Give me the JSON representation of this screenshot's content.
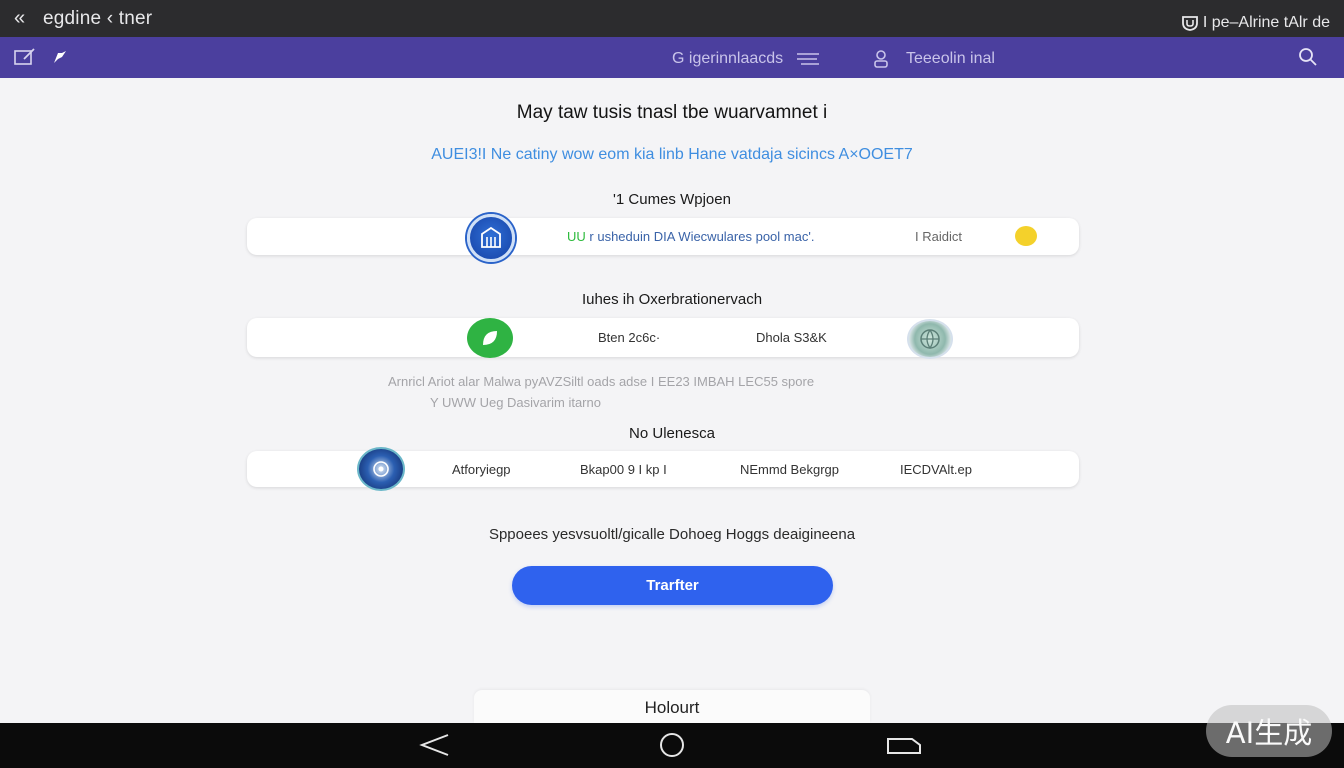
{
  "topbar": {
    "back_glyph": "«",
    "title": "egdine ‹ tner",
    "right_text": "I pe–Alrine tAlr de"
  },
  "navbar": {
    "center_label": "G igerinnlaacds",
    "right_label": "Teeeolin inal"
  },
  "main": {
    "headline": "May taw tusis tnasl tbe wuarvamnet i",
    "subline": "AUEI3!I Ne catiny wow eom kia linb Hane vatdaja sicincs A×OOET7",
    "section1": {
      "title": "'1 Cumes Wpjoen",
      "text_green": "UU",
      "text_main": "r usheduin DIA Wiecwulares pool mac'.",
      "right_label": "I Raidict"
    },
    "section2": {
      "title": "Iuhes ih Oxerbrationervach",
      "item_a": "Bten 2c6c·",
      "item_b": "Dhola S3&K"
    },
    "note_line1": "Arnricl Ariot alar Malwa pyAVZSiltl oads adse    I EE23 IMBAH LEC55 spore",
    "note_line2": "Y UWW Ueg Dasivarim itarno",
    "section3": {
      "title": "No Ulenesca",
      "items": [
        "Atforyiegp",
        "Bkap00 9 I kp I",
        "NEmmd Bekgrgp",
        "IECDVAlt.ep"
      ]
    },
    "helper_text": "Sppoees yesvsuoltl/gicalle Dohoeg Hoggs deaigineena",
    "primary_button": "Trarfter",
    "secondary_button": "Holourt"
  },
  "watermark": "AI生成",
  "colors": {
    "topbar": "#2c2c2e",
    "navbar": "#4b3f9e",
    "accent_blue": "#2f62ee",
    "link_blue": "#3f8ee0",
    "green": "#2fb343"
  }
}
